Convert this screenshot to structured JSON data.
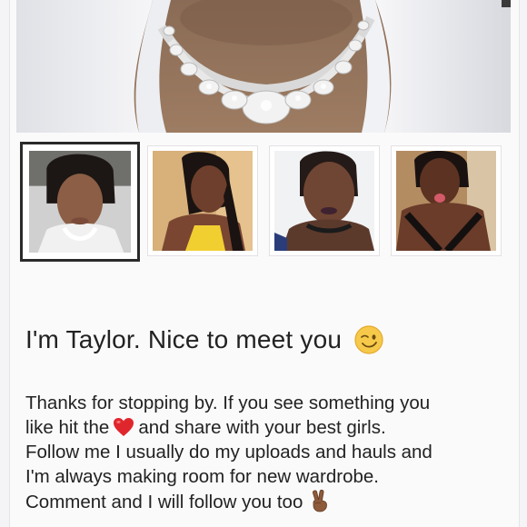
{
  "profile": {
    "greeting": "I'm Taylor. Nice to meet you",
    "greeting_emoji": "winking-face-emoji",
    "bio": {
      "line1": "Thanks for stopping by. If you see something you",
      "line2_before": "like hit the",
      "line2_after": "and share with your best girls.",
      "line3": "Follow me I usually do my uploads and hauls and",
      "line4": "I'm always making room for new wardrobe.",
      "line5": "Comment and I will follow you too",
      "heart_icon": "red-heart-emoji",
      "peace_icon": "victory-hand-emoji"
    }
  },
  "gallery": {
    "cover_icon": "cover-photo-necklace",
    "thumbnails": [
      {
        "name": "thumbnail-1",
        "selected": true
      },
      {
        "name": "thumbnail-2",
        "selected": false
      },
      {
        "name": "thumbnail-3",
        "selected": false
      },
      {
        "name": "thumbnail-4",
        "selected": false
      }
    ]
  },
  "colors": {
    "heart": "#e0262d",
    "selected_border": "#2a2a2a",
    "text": "#222222"
  }
}
